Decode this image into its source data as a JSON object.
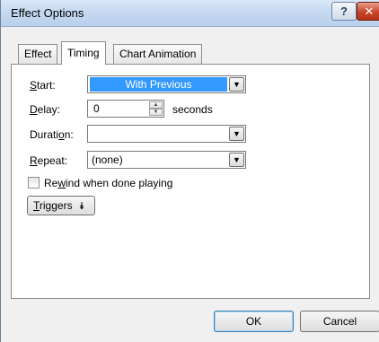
{
  "window": {
    "title": "Effect Options",
    "help_glyph": "?",
    "close_glyph": "✕"
  },
  "tabs": [
    {
      "label": "Effect",
      "selected": false
    },
    {
      "label": "Timing",
      "selected": true
    },
    {
      "label": "Chart Animation",
      "selected": false
    }
  ],
  "timing": {
    "start": {
      "label_u": "S",
      "label_rest": "tart:",
      "value": "With Previous"
    },
    "delay": {
      "label_u": "D",
      "label_rest": "elay:",
      "value": "0",
      "unit": "seconds"
    },
    "duration": {
      "label_pre": "Durati",
      "label_u": "o",
      "label_rest": "n:",
      "value": ""
    },
    "repeat": {
      "label_u": "R",
      "label_rest": "epeat:",
      "value": "(none)"
    },
    "rewind": {
      "label_pre": "Re",
      "label_u": "w",
      "label_rest": "ind when done playing",
      "checked": false
    },
    "triggers": {
      "label_u": "T",
      "label_rest": "riggers",
      "glyph": "⯯"
    }
  },
  "buttons": {
    "ok": "OK",
    "cancel": "Cancel"
  },
  "colors": {
    "selection": "#3399ff",
    "titlebar": "#c6d9f1"
  }
}
